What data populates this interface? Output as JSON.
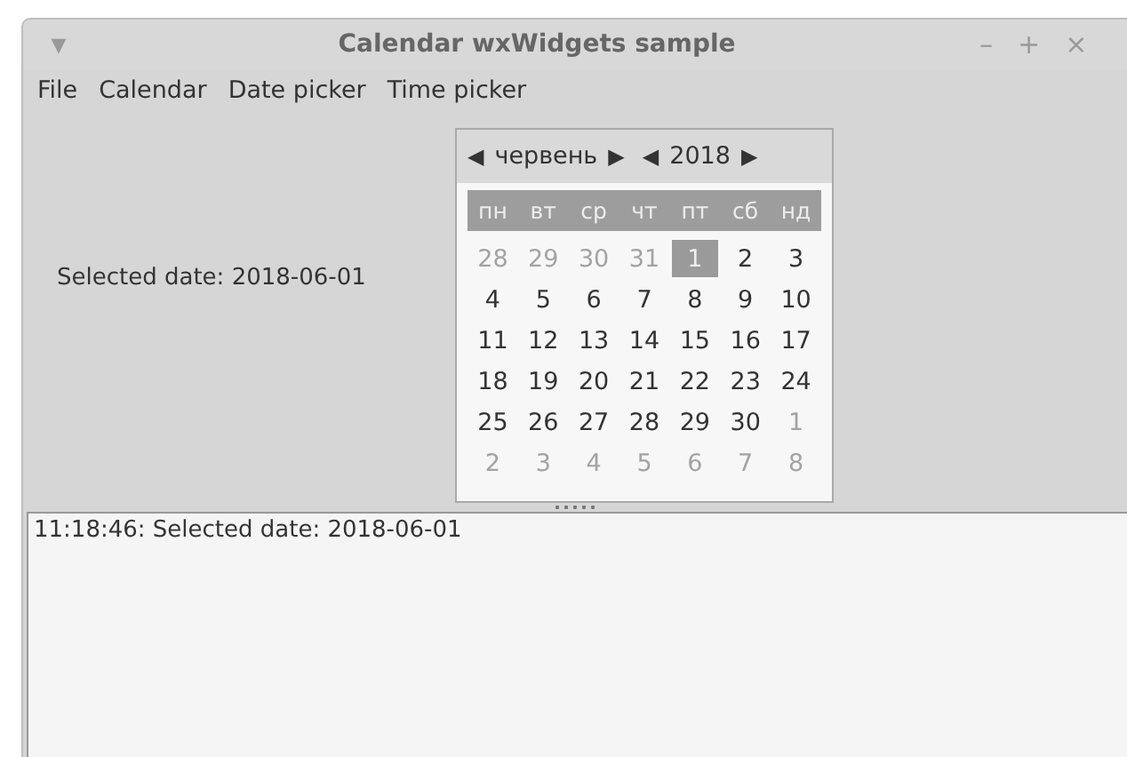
{
  "window": {
    "title": "Calendar wxWidgets sample",
    "menu_glyph": "▼",
    "controls": [
      "–",
      "+",
      "×"
    ]
  },
  "menu": [
    "File",
    "Calendar",
    "Date picker",
    "Time picker"
  ],
  "selected_label": "Selected date: 2018-06-01",
  "calendar": {
    "month_prev": "◀",
    "month": "червень",
    "month_next": "▶",
    "year_prev": "◀",
    "year": "2018",
    "year_next": "▶",
    "weekdays": [
      "пн",
      "вт",
      "ср",
      "чт",
      "пт",
      "сб",
      "нд"
    ],
    "days": [
      {
        "label": "28",
        "other_month": true,
        "selected": false
      },
      {
        "label": "29",
        "other_month": true,
        "selected": false
      },
      {
        "label": "30",
        "other_month": true,
        "selected": false
      },
      {
        "label": "31",
        "other_month": true,
        "selected": false
      },
      {
        "label": "1",
        "other_month": false,
        "selected": true
      },
      {
        "label": "2",
        "other_month": false,
        "selected": false
      },
      {
        "label": "3",
        "other_month": false,
        "selected": false
      },
      {
        "label": "4",
        "other_month": false,
        "selected": false
      },
      {
        "label": "5",
        "other_month": false,
        "selected": false
      },
      {
        "label": "6",
        "other_month": false,
        "selected": false
      },
      {
        "label": "7",
        "other_month": false,
        "selected": false
      },
      {
        "label": "8",
        "other_month": false,
        "selected": false
      },
      {
        "label": "9",
        "other_month": false,
        "selected": false
      },
      {
        "label": "10",
        "other_month": false,
        "selected": false
      },
      {
        "label": "11",
        "other_month": false,
        "selected": false
      },
      {
        "label": "12",
        "other_month": false,
        "selected": false
      },
      {
        "label": "13",
        "other_month": false,
        "selected": false
      },
      {
        "label": "14",
        "other_month": false,
        "selected": false
      },
      {
        "label": "15",
        "other_month": false,
        "selected": false
      },
      {
        "label": "16",
        "other_month": false,
        "selected": false
      },
      {
        "label": "17",
        "other_month": false,
        "selected": false
      },
      {
        "label": "18",
        "other_month": false,
        "selected": false
      },
      {
        "label": "19",
        "other_month": false,
        "selected": false
      },
      {
        "label": "20",
        "other_month": false,
        "selected": false
      },
      {
        "label": "21",
        "other_month": false,
        "selected": false
      },
      {
        "label": "22",
        "other_month": false,
        "selected": false
      },
      {
        "label": "23",
        "other_month": false,
        "selected": false
      },
      {
        "label": "24",
        "other_month": false,
        "selected": false
      },
      {
        "label": "25",
        "other_month": false,
        "selected": false
      },
      {
        "label": "26",
        "other_month": false,
        "selected": false
      },
      {
        "label": "27",
        "other_month": false,
        "selected": false
      },
      {
        "label": "28",
        "other_month": false,
        "selected": false
      },
      {
        "label": "29",
        "other_month": false,
        "selected": false
      },
      {
        "label": "30",
        "other_month": false,
        "selected": false
      },
      {
        "label": "1",
        "other_month": true,
        "selected": false
      },
      {
        "label": "2",
        "other_month": true,
        "selected": false
      },
      {
        "label": "3",
        "other_month": true,
        "selected": false
      },
      {
        "label": "4",
        "other_month": true,
        "selected": false
      },
      {
        "label": "5",
        "other_month": true,
        "selected": false
      },
      {
        "label": "6",
        "other_month": true,
        "selected": false
      },
      {
        "label": "7",
        "other_month": true,
        "selected": false
      },
      {
        "label": "8",
        "other_month": true,
        "selected": false
      }
    ]
  },
  "log": [
    "11:18:46: Selected date: 2018-06-01"
  ]
}
